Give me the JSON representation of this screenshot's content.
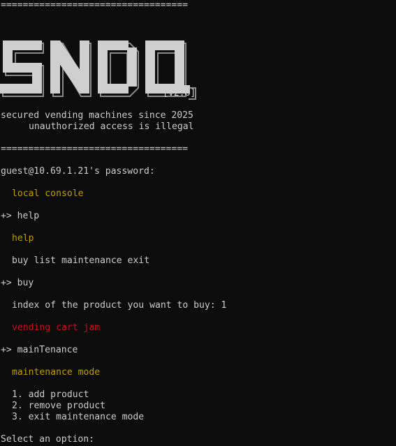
{
  "terminal": {
    "rule_top": "==================================",
    "logo_text": "SNDO",
    "version": "[v2.8]",
    "tagline_1": "secured vending machines since 2025",
    "tagline_2": "unauthorized access is illegal",
    "rule_bottom": "==================================",
    "prompt_password": "guest@10.69.1.21's password:",
    "msg_local_console": "local console",
    "cmd_help": "+> help",
    "msg_help": "help",
    "help_commands": "buy list maintenance exit",
    "cmd_buy": "+> buy",
    "buy_prompt": "index of the product you want to buy: 1",
    "msg_error": "vending cart jam",
    "cmd_maintenance": "+> mainTenance",
    "msg_maintenance": "maintenance mode",
    "menu": [
      "1. add product",
      "2. remove product",
      "3. exit maintenance mode"
    ],
    "select_prompt": "Select an option:"
  },
  "colors": {
    "background": "#0c0c0c",
    "text": "#cccccc",
    "highlight": "#c19c00",
    "error": "#c50f1f"
  }
}
